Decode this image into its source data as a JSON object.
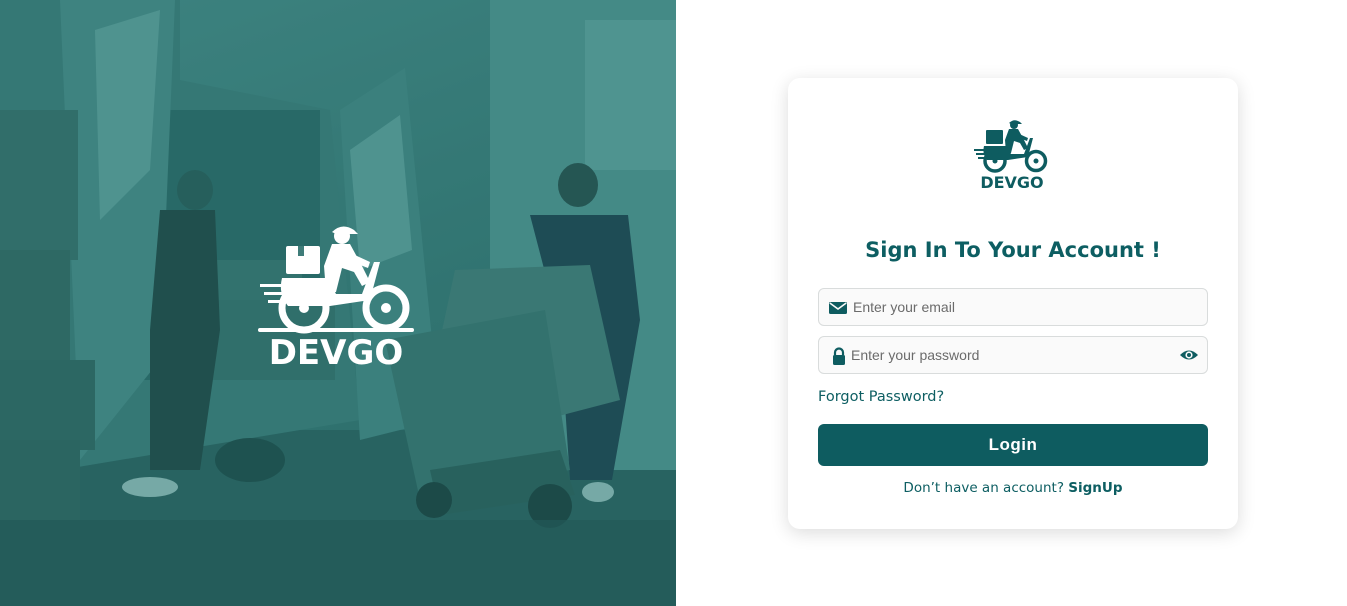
{
  "colors": {
    "brand": "#0e5c60",
    "hero_tint": "#3f7c79",
    "card_bg": "#ffffff"
  },
  "hero": {
    "logo_text": "DEVGO",
    "logo_icon": "delivery-scooter-icon"
  },
  "card": {
    "logo_text": "DEVGO",
    "title": "Sign In To Your Account !",
    "email": {
      "icon": "envelope-icon",
      "placeholder": "Enter your email",
      "value": ""
    },
    "password": {
      "icon": "lock-icon",
      "placeholder": "Enter your password",
      "value": "",
      "toggle_icon": "eye-icon"
    },
    "forgot_label": "Forgot Password?",
    "login_label": "Login",
    "signup_prompt": "Don’t have an account?",
    "signup_label": "SignUp"
  }
}
